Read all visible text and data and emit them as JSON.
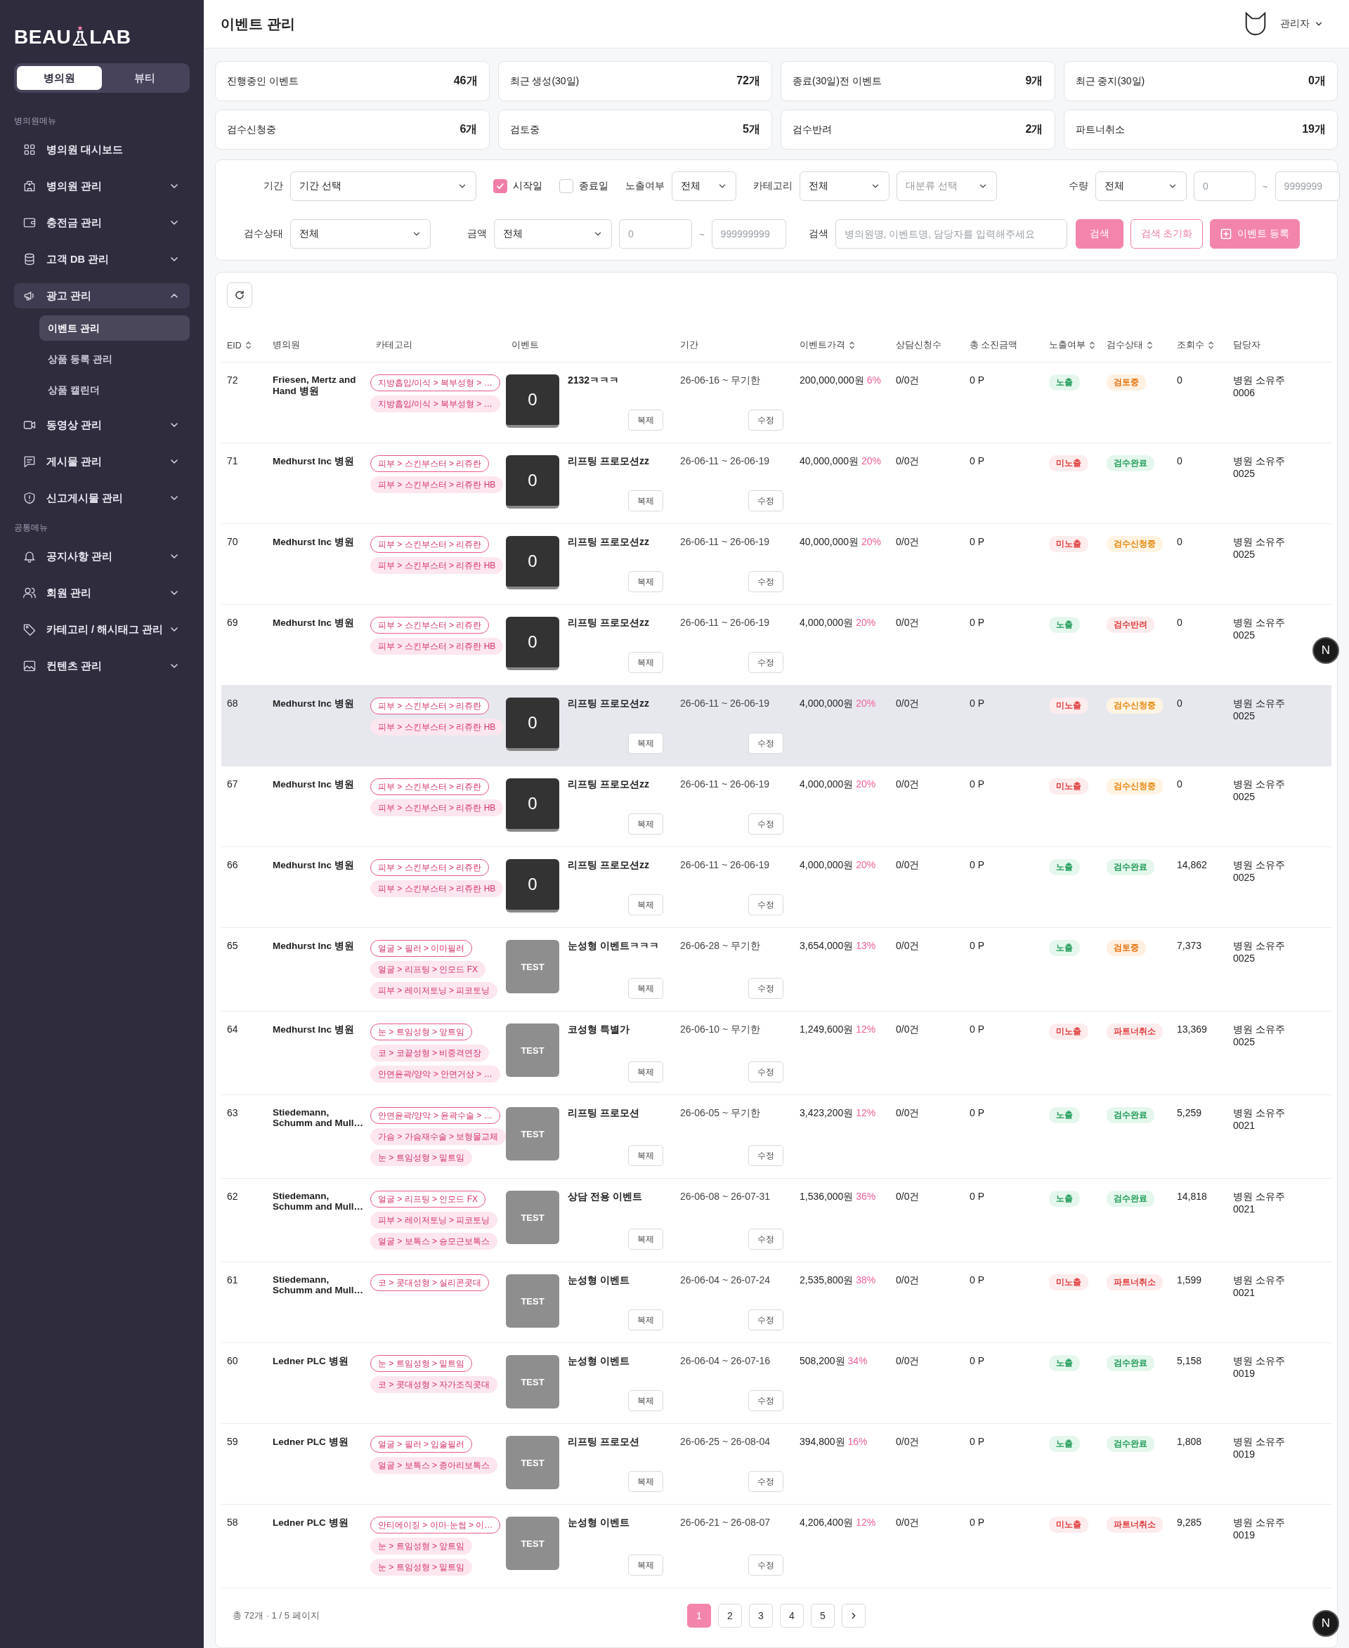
{
  "sidebar": {
    "logo": {
      "left": "BEAU",
      "right": "LAB"
    },
    "segments": [
      {
        "label": "병의원",
        "selected": true
      },
      {
        "label": "뷰티",
        "selected": false
      }
    ],
    "sections": [
      {
        "title": "병의원메뉴",
        "items": [
          {
            "label": "병의원 대시보드",
            "kind": "link",
            "selected": false
          },
          {
            "label": "병의원 관리",
            "kind": "group",
            "expanded": false,
            "selected": false
          },
          {
            "label": "충전금 관리",
            "kind": "group",
            "expanded": false,
            "selected": false
          },
          {
            "label": "고객 DB 관리",
            "kind": "group",
            "expanded": false,
            "selected": false
          },
          {
            "label": "광고 관리",
            "kind": "group",
            "expanded": true,
            "selected": true,
            "children": [
              {
                "label": "이벤트 관리",
                "selected": true
              },
              {
                "label": "상품 등록 관리",
                "selected": false
              },
              {
                "label": "상품 캘린더",
                "selected": false
              }
            ]
          },
          {
            "label": "동영상 관리",
            "kind": "group",
            "expanded": false,
            "selected": false
          },
          {
            "label": "게시물 관리",
            "kind": "group",
            "expanded": false,
            "selected": false
          },
          {
            "label": "신고게시물 관리",
            "kind": "group",
            "expanded": false,
            "selected": false
          }
        ]
      },
      {
        "title": "공통메뉴",
        "items": [
          {
            "label": "공지사항 관리",
            "kind": "group",
            "expanded": false,
            "selected": false
          },
          {
            "label": "회원 관리",
            "kind": "group",
            "expanded": false,
            "selected": false
          },
          {
            "label": "카테고리 / 해시태그 관리",
            "kind": "group",
            "expanded": false,
            "selected": false
          },
          {
            "label": "컨텐츠 관리",
            "kind": "group",
            "expanded": false,
            "selected": false
          }
        ]
      }
    ]
  },
  "header": {
    "title": "이벤트 관리",
    "user": "관리자"
  },
  "stats": [
    {
      "label": "진행중인 이벤트",
      "value": "46개"
    },
    {
      "label": "최근 생성(30일)",
      "value": "72개"
    },
    {
      "label": "종료(30일)전 이벤트",
      "value": "9개"
    },
    {
      "label": "최근 중지(30일)",
      "value": "0개"
    },
    {
      "label": "검수신청중",
      "value": "6개"
    },
    {
      "label": "검토중",
      "value": "5개"
    },
    {
      "label": "검수반려",
      "value": "2개"
    },
    {
      "label": "파트너취소",
      "value": "19개"
    }
  ],
  "filters": {
    "period": {
      "label": "기간",
      "value": "기간 선택"
    },
    "date_options": [
      {
        "label": "시작일",
        "checked": true
      },
      {
        "label": "종료일",
        "checked": false
      }
    ],
    "exposure": {
      "label": "노출여부",
      "value": "전체"
    },
    "category": {
      "label": "카테고리",
      "value": "전체",
      "sub_placeholder": "대분류 선택"
    },
    "quantity": {
      "label": "수량",
      "value": "전체",
      "min_placeholder": "0",
      "separator": "~",
      "max_placeholder": "9999999"
    },
    "review": {
      "label": "검수상태",
      "value": "전체"
    },
    "amount": {
      "label": "금액",
      "value": "전체",
      "min_placeholder": "0",
      "separator": "~",
      "max_placeholder": "999999999"
    },
    "search": {
      "label": "검색",
      "placeholder": "병의원명, 이벤트명, 담당자를 입력해주세요"
    },
    "buttons": [
      {
        "label": "검색",
        "kind": "primary"
      },
      {
        "label": "검색 초기화",
        "kind": "outline"
      },
      {
        "label": "이벤트 등록",
        "kind": "add"
      }
    ]
  },
  "table": {
    "columns": [
      {
        "label": "EID",
        "sortable": true
      },
      {
        "label": "병의원",
        "sortable": false
      },
      {
        "label": "카테고리",
        "sortable": false
      },
      {
        "label": "이벤트",
        "sortable": false
      },
      {
        "label": "기간",
        "sortable": false
      },
      {
        "label": "이벤트가격",
        "sortable": true
      },
      {
        "label": "상담신청수",
        "sortable": false
      },
      {
        "label": "총 소진금액",
        "sortable": false
      },
      {
        "label": "노출여부",
        "sortable": true
      },
      {
        "label": "검수상태",
        "sortable": true
      },
      {
        "label": "조회수",
        "sortable": true
      },
      {
        "label": "담당자",
        "sortable": false
      }
    ],
    "rows": [
      {
        "eid": "72",
        "hospital": "Friesen, Mertz and Hand 병원",
        "tags": [
          "지방흡입/이식 > 복부성형 > …",
          "지방흡입/이식 > 복부성형 > …"
        ],
        "thumb": {
          "kind": "dark",
          "text": "0"
        },
        "event": "2132ㅋㅋㅋ",
        "copy": "복제",
        "period": "26-06-16 ~ 무기한",
        "edit": "수정",
        "price": "200,000,000원",
        "discount": "6%",
        "consults": "0/0건",
        "spent": "0 P",
        "exposure": {
          "label": "노출",
          "kind": "on"
        },
        "review": {
          "label": "검토중",
          "kind": "reviewing"
        },
        "views": "0",
        "manager": "병원 소유주 0006",
        "highlighted": false
      },
      {
        "eid": "71",
        "hospital": "Medhurst Inc 병원",
        "tags": [
          "피부 > 스킨부스터 > 리쥬란",
          "피부 > 스킨부스터 > 리쥬란 HB"
        ],
        "thumb": {
          "kind": "dark",
          "text": "0"
        },
        "event": "리프팅 프로모션zz",
        "copy": "복제",
        "period": "26-06-11 ~ 26-06-19",
        "edit": "수정",
        "price": "40,000,000원",
        "discount": "20%",
        "consults": "0/0건",
        "spent": "0 P",
        "exposure": {
          "label": "미노출",
          "kind": "off"
        },
        "review": {
          "label": "검수완료",
          "kind": "approved"
        },
        "views": "0",
        "manager": "병원 소유주 0025",
        "highlighted": false
      },
      {
        "eid": "70",
        "hospital": "Medhurst Inc 병원",
        "tags": [
          "피부 > 스킨부스터 > 리쥬란",
          "피부 > 스킨부스터 > 리쥬란 HB"
        ],
        "thumb": {
          "kind": "dark",
          "text": "0"
        },
        "event": "리프팅 프로모션zz",
        "copy": "복제",
        "period": "26-06-11 ~ 26-06-19",
        "edit": "수정",
        "price": "40,000,000원",
        "discount": "20%",
        "consults": "0/0건",
        "spent": "0 P",
        "exposure": {
          "label": "미노출",
          "kind": "off"
        },
        "review": {
          "label": "검수신청중",
          "kind": "requested"
        },
        "views": "0",
        "manager": "병원 소유주 0025",
        "highlighted": false
      },
      {
        "eid": "69",
        "hospital": "Medhurst Inc 병원",
        "tags": [
          "피부 > 스킨부스터 > 리쥬란",
          "피부 > 스킨부스터 > 리쥬란 HB"
        ],
        "thumb": {
          "kind": "dark",
          "text": "0"
        },
        "event": "리프팅 프로모션zz",
        "copy": "복제",
        "period": "26-06-11 ~ 26-06-19",
        "edit": "수정",
        "price": "4,000,000원",
        "discount": "20%",
        "consults": "0/0건",
        "spent": "0 P",
        "exposure": {
          "label": "노출",
          "kind": "on"
        },
        "review": {
          "label": "검수반려",
          "kind": "rejected"
        },
        "views": "0",
        "manager": "병원 소유주 0025",
        "highlighted": false
      },
      {
        "eid": "68",
        "hospital": "Medhurst Inc 병원",
        "tags": [
          "피부 > 스킨부스터 > 리쥬란",
          "피부 > 스킨부스터 > 리쥬란 HB"
        ],
        "thumb": {
          "kind": "dark",
          "text": "0"
        },
        "event": "리프팅 프로모션zz",
        "copy": "복제",
        "period": "26-06-11 ~ 26-06-19",
        "edit": "수정",
        "price": "4,000,000원",
        "discount": "20%",
        "consults": "0/0건",
        "spent": "0 P",
        "exposure": {
          "label": "미노출",
          "kind": "off"
        },
        "review": {
          "label": "검수신청중",
          "kind": "requested"
        },
        "views": "0",
        "manager": "병원 소유주 0025",
        "highlighted": true
      },
      {
        "eid": "67",
        "hospital": "Medhurst Inc 병원",
        "tags": [
          "피부 > 스킨부스터 > 리쥬란",
          "피부 > 스킨부스터 > 리쥬란 HB"
        ],
        "thumb": {
          "kind": "dark",
          "text": "0"
        },
        "event": "리프팅 프로모션zz",
        "copy": "복제",
        "period": "26-06-11 ~ 26-06-19",
        "edit": "수정",
        "price": "4,000,000원",
        "discount": "20%",
        "consults": "0/0건",
        "spent": "0 P",
        "exposure": {
          "label": "미노출",
          "kind": "off"
        },
        "review": {
          "label": "검수신청중",
          "kind": "requested"
        },
        "views": "0",
        "manager": "병원 소유주 0025",
        "highlighted": false
      },
      {
        "eid": "66",
        "hospital": "Medhurst Inc 병원",
        "tags": [
          "피부 > 스킨부스터 > 리쥬란",
          "피부 > 스킨부스터 > 리쥬란 HB"
        ],
        "thumb": {
          "kind": "dark",
          "text": "0"
        },
        "event": "리프팅 프로모션zz",
        "copy": "복제",
        "period": "26-06-11 ~ 26-06-19",
        "edit": "수정",
        "price": "4,000,000원",
        "discount": "20%",
        "consults": "0/0건",
        "spent": "0 P",
        "exposure": {
          "label": "노출",
          "kind": "on"
        },
        "review": {
          "label": "검수완료",
          "kind": "approved"
        },
        "views": "14,862",
        "manager": "병원 소유주 0025",
        "highlighted": false
      },
      {
        "eid": "65",
        "hospital": "Medhurst Inc 병원",
        "tags": [
          "얼굴 > 필러 > 이마필러",
          "얼굴 > 리프팅 > 인모드 FX",
          "피부 > 레이저토닝 > 피코토닝"
        ],
        "thumb": {
          "kind": "gray",
          "text": "TEST"
        },
        "event": "눈성형 이벤트ㅋㅋㅋ",
        "copy": "복제",
        "period": "26-06-28 ~ 무기한",
        "edit": "수정",
        "price": "3,654,000원",
        "discount": "13%",
        "consults": "0/0건",
        "spent": "0 P",
        "exposure": {
          "label": "노출",
          "kind": "on"
        },
        "review": {
          "label": "검토중",
          "kind": "reviewing"
        },
        "views": "7,373",
        "manager": "병원 소유주 0025",
        "highlighted": false
      },
      {
        "eid": "64",
        "hospital": "Medhurst Inc 병원",
        "tags": [
          "눈 > 트임성형 > 앞트임",
          "코 > 코끝성형 > 비중격연장",
          "안면윤곽/양악 > 안면거상 > …"
        ],
        "thumb": {
          "kind": "gray",
          "text": "TEST"
        },
        "event": "코성형 특별가",
        "copy": "복제",
        "period": "26-06-10 ~ 무기한",
        "edit": "수정",
        "price": "1,249,600원",
        "discount": "12%",
        "consults": "0/0건",
        "spent": "0 P",
        "exposure": {
          "label": "미노출",
          "kind": "off"
        },
        "review": {
          "label": "파트너취소",
          "kind": "cancelled"
        },
        "views": "13,369",
        "manager": "병원 소유주 0025",
        "highlighted": false
      },
      {
        "eid": "63",
        "hospital": "Stiedemann, Schumm and Mull…",
        "tags": [
          "안면윤곽/양악 > 윤곽수술 > …",
          "가슴 > 가슴재수술 > 보형물교체",
          "눈 > 트임성형 > 밑트임"
        ],
        "thumb": {
          "kind": "gray",
          "text": "TEST"
        },
        "event": "리프팅 프로모션",
        "copy": "복제",
        "period": "26-06-05 ~ 무기한",
        "edit": "수정",
        "price": "3,423,200원",
        "discount": "12%",
        "consults": "0/0건",
        "spent": "0 P",
        "exposure": {
          "label": "노출",
          "kind": "on"
        },
        "review": {
          "label": "검수완료",
          "kind": "approved"
        },
        "views": "5,259",
        "manager": "병원 소유주 0021",
        "highlighted": false
      },
      {
        "eid": "62",
        "hospital": "Stiedemann, Schumm and Mull…",
        "tags": [
          "얼굴 > 리프팅 > 인모드 FX",
          "피부 > 레이저토닝 > 피코토닝",
          "얼굴 > 보톡스 > 승모근보톡스"
        ],
        "thumb": {
          "kind": "gray",
          "text": "TEST"
        },
        "event": "상담 전용 이벤트",
        "copy": "복제",
        "period": "26-06-08 ~ 26-07-31",
        "edit": "수정",
        "price": "1,536,000원",
        "discount": "36%",
        "consults": "0/0건",
        "spent": "0 P",
        "exposure": {
          "label": "노출",
          "kind": "on"
        },
        "review": {
          "label": "검수완료",
          "kind": "approved"
        },
        "views": "14,818",
        "manager": "병원 소유주 0021",
        "highlighted": false
      },
      {
        "eid": "61",
        "hospital": "Stiedemann, Schumm and Mull…",
        "tags": [
          "코 > 콧대성형 > 실리콘콧대"
        ],
        "thumb": {
          "kind": "gray",
          "text": "TEST"
        },
        "event": "눈성형 이벤트",
        "copy": "복제",
        "period": "26-06-04 ~ 26-07-24",
        "edit": "수정",
        "price": "2,535,800원",
        "discount": "38%",
        "consults": "0/0건",
        "spent": "0 P",
        "exposure": {
          "label": "미노출",
          "kind": "off"
        },
        "review": {
          "label": "파트너취소",
          "kind": "cancelled"
        },
        "views": "1,599",
        "manager": "병원 소유주 0021",
        "highlighted": false
      },
      {
        "eid": "60",
        "hospital": "Ledner PLC 병원",
        "tags": [
          "눈 > 트임성형 > 밑트임",
          "코 > 콧대성형 > 자가조직콧대"
        ],
        "thumb": {
          "kind": "gray",
          "text": "TEST"
        },
        "event": "눈성형 이벤트",
        "copy": "복제",
        "period": "26-06-04 ~ 26-07-16",
        "edit": "수정",
        "price": "508,200원",
        "discount": "34%",
        "consults": "0/0건",
        "spent": "0 P",
        "exposure": {
          "label": "노출",
          "kind": "on"
        },
        "review": {
          "label": "검수완료",
          "kind": "approved"
        },
        "views": "5,158",
        "manager": "병원 소유주 0019",
        "highlighted": false
      },
      {
        "eid": "59",
        "hospital": "Ledner PLC 병원",
        "tags": [
          "얼굴 > 필러 > 입술필러",
          "얼굴 > 보톡스 > 종아리보톡스"
        ],
        "thumb": {
          "kind": "gray",
          "text": "TEST"
        },
        "event": "리프팅 프로모션",
        "copy": "복제",
        "period": "26-06-25 ~ 26-08-04",
        "edit": "수정",
        "price": "394,800원",
        "discount": "16%",
        "consults": "0/0건",
        "spent": "0 P",
        "exposure": {
          "label": "노출",
          "kind": "on"
        },
        "review": {
          "label": "검수완료",
          "kind": "approved"
        },
        "views": "1,808",
        "manager": "병원 소유주 0019",
        "highlighted": false
      },
      {
        "eid": "58",
        "hospital": "Ledner PLC 병원",
        "tags": [
          "안티에이징 > 이마·눈썹 > 이…",
          "눈 > 트임성형 > 앞트임",
          "눈 > 트임성형 > 밑트임"
        ],
        "thumb": {
          "kind": "gray",
          "text": "TEST"
        },
        "event": "눈성형 이벤트",
        "copy": "복제",
        "period": "26-06-21 ~ 26-08-07",
        "edit": "수정",
        "price": "4,206,400원",
        "discount": "12%",
        "consults": "0/0건",
        "spent": "0 P",
        "exposure": {
          "label": "미노출",
          "kind": "off"
        },
        "review": {
          "label": "파트너취소",
          "kind": "cancelled"
        },
        "views": "9,285",
        "manager": "병원 소유주 0019",
        "highlighted": false
      }
    ]
  },
  "pagination": {
    "summary": "총 72개 · 1 / 5 페이지",
    "pages": [
      {
        "label": "1",
        "selected": true
      },
      {
        "label": "2",
        "selected": false
      },
      {
        "label": "3",
        "selected": false
      },
      {
        "label": "4",
        "selected": false
      },
      {
        "label": "5",
        "selected": false
      }
    ]
  },
  "dev_badges": [
    {
      "label": "N"
    },
    {
      "label": "N"
    }
  ]
}
